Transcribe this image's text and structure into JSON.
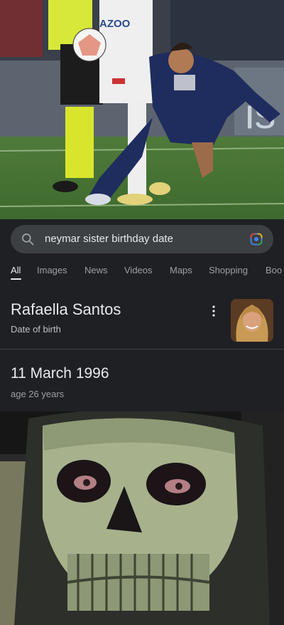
{
  "search": {
    "query": "neymar sister birthday date"
  },
  "tabs": [
    "All",
    "Images",
    "News",
    "Videos",
    "Maps",
    "Shopping",
    "Boo"
  ],
  "knowledge_panel": {
    "name": "Rafaella Santos",
    "subtitle": "Date of birth",
    "answer": "11 March 1996",
    "age": "age 26 years"
  },
  "photo_top": {
    "jersey_text": "AZOO"
  },
  "colors": {
    "page_bg": "#1f2023",
    "search_bg": "#3c4043",
    "text_primary": "#e8eaed",
    "text_secondary": "#9aa0a6"
  },
  "icons": [
    "search-icon",
    "google-lens-icon",
    "more-vert-icon"
  ]
}
